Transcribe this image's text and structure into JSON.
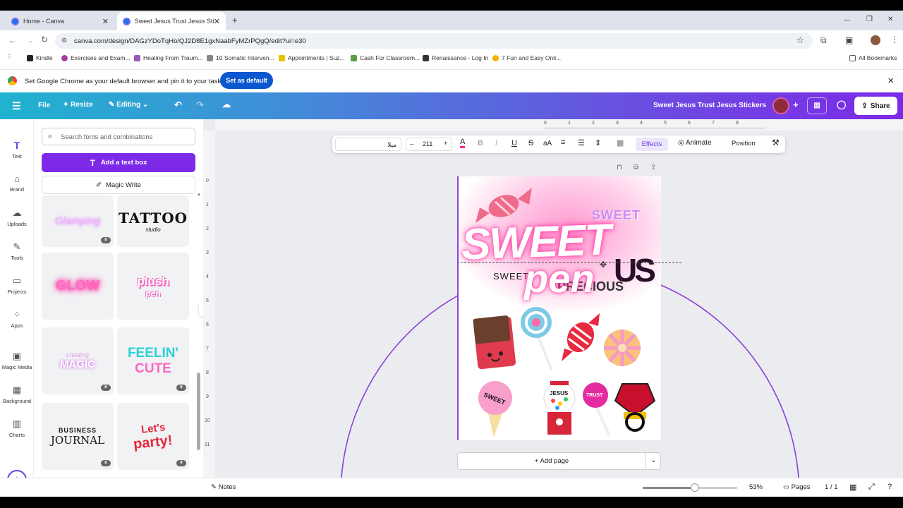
{
  "tabs": [
    {
      "title": "Home - Canva",
      "close": "✕"
    },
    {
      "title": "Sweet Jesus Trust Jesus Stickers",
      "close": "✕"
    }
  ],
  "new_tab": "+",
  "window_controls": {
    "minimize": "—",
    "restore": "❐",
    "close": "✕"
  },
  "address": {
    "url": "canva.com/design/DAGzYDoTqHo/QJ2D8E1gxNaabFyMZrPQgQ/edit?ui=e30"
  },
  "bookmarks": {
    "items": [
      {
        "label": "Kindle",
        "color": "#222"
      },
      {
        "label": "Exercises and Exam...",
        "color": "#a33ba3"
      },
      {
        "label": "Healing From Traum...",
        "color": "#9b59b6"
      },
      {
        "label": "10 Somatic Interven...",
        "color": "#888"
      },
      {
        "label": "Appointments | Suz...",
        "color": "#e6c300"
      },
      {
        "label": "Cash For Classroom...",
        "color": "#5a9d4a"
      },
      {
        "label": "Renaissance - Log In",
        "color": "#333"
      },
      {
        "label": "7 Fun and Easy Onli...",
        "color": "#f4b400"
      }
    ],
    "all": "All Bookmarks"
  },
  "infobar": {
    "message": "Set Google Chrome as your default browser and pin it to your taskbar",
    "button": "Set as default",
    "close": "✕"
  },
  "canva_header": {
    "file": "File",
    "resize": "Resize",
    "editing": "Editing",
    "title": "Sweet Jesus Trust Jesus Stickers",
    "share": "Share",
    "plus": "+"
  },
  "rail": [
    {
      "label": "Text",
      "icon": "T"
    },
    {
      "label": "Brand",
      "icon": "⌂"
    },
    {
      "label": "Uploads",
      "icon": "☁"
    },
    {
      "label": "Tools",
      "icon": "✎"
    },
    {
      "label": "Projects",
      "icon": "▭"
    },
    {
      "label": "Apps",
      "icon": "⁘"
    },
    {
      "label": "Magic Media",
      "icon": "▣"
    },
    {
      "label": "Background",
      "icon": "▦"
    },
    {
      "label": "Charts",
      "icon": "▥"
    }
  ],
  "panel": {
    "search_placeholder": "Search fonts and combinations",
    "add_text_box": "Add a text box",
    "magic_write": "Magic Write",
    "cards": [
      {
        "text": "Glamping",
        "style": "glamping"
      },
      {
        "text": "TATTOO",
        "sub": "studio",
        "style": "tattoo"
      },
      {
        "text": "GLOW",
        "style": "glow"
      },
      {
        "text": "plush",
        "sub": "pen",
        "style": "plush"
      },
      {
        "text": "creating",
        "sub": "MAGIC",
        "style": "magic"
      },
      {
        "text": "FEELIN'",
        "sub": "CUTE",
        "style": "feelin"
      },
      {
        "text": "BUSINESS",
        "sub": "JOURNAL",
        "style": "journal"
      },
      {
        "text": "Let's",
        "sub": "party!",
        "style": "party"
      }
    ]
  },
  "ruler": {
    "h": [
      "0",
      "1",
      "2",
      "3",
      "4",
      "5",
      "6",
      "7",
      "8"
    ],
    "v": [
      "0",
      "1",
      "2",
      "3",
      "4",
      "5",
      "6",
      "7",
      "8",
      "9",
      "10",
      "11"
    ]
  },
  "toolbar": {
    "font": "ﻣﻴﻼ",
    "minus": "–",
    "size": "211",
    "plus": "+",
    "text_color": "A",
    "bold": "B",
    "italic": "I",
    "underline": "U",
    "strike": "S",
    "case": "aA",
    "effects": "Effects",
    "animate": "Animate",
    "position": "Position"
  },
  "design": {
    "sweet_small": "SWEET",
    "sweet_big": "SWEET",
    "pen": "pen",
    "sweet_left": "SWEET",
    "jesus_partial": "US",
    "precious": "PRECIOUS",
    "sticker_sweet": "SWEET",
    "sticker_jesus": "JESUS",
    "sticker_trust": "TRUST"
  },
  "add_page": "+ Add page",
  "add_page_chevron": "⌄",
  "footer": {
    "notes": "Notes",
    "zoom": "53%",
    "zoom_fraction": 0.55,
    "pages": "Pages",
    "page_count": "1 / 1"
  },
  "colors": {
    "canva_purple": "#7d2ae8",
    "canva_teal": "#1fb3cf",
    "chrome_blue": "#0b57d0",
    "pink": "#ff4fa3"
  }
}
